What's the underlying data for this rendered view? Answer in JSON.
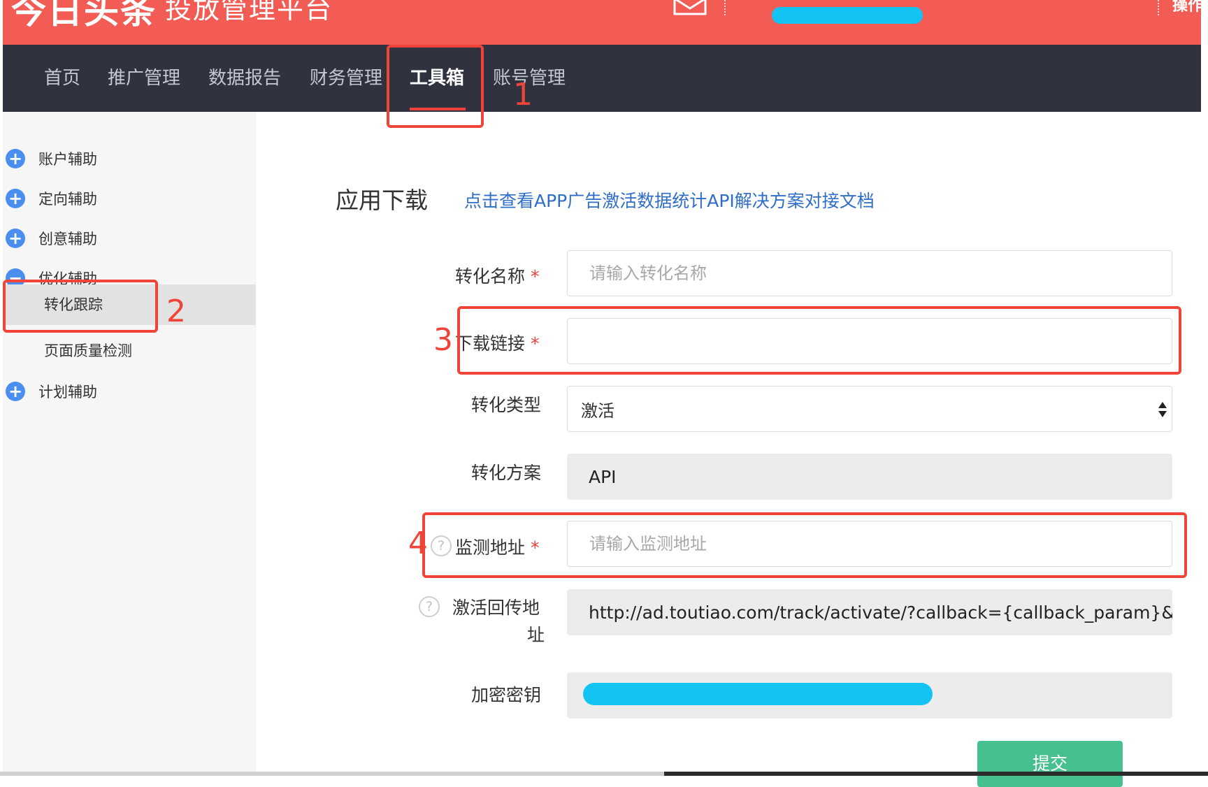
{
  "topbar": {
    "brand_logo": "今日头条",
    "brand_sub": "投放管理平台",
    "right_text": "操作",
    "icons": [
      "mail-icon"
    ],
    "user_masked_color": "#12c3f4"
  },
  "nav": {
    "items": [
      "首页",
      "推广管理",
      "数据报告",
      "财务管理",
      "工具箱",
      "账号管理"
    ],
    "active_index": 4
  },
  "sidebar": {
    "groups": [
      {
        "label": "账户辅助",
        "icon": "plus-icon"
      },
      {
        "label": "定向辅助",
        "icon": "plus-icon"
      },
      {
        "label": "创意辅助",
        "icon": "plus-icon"
      },
      {
        "label": "优化辅助",
        "icon": "minus-icon"
      },
      {
        "label": "计划辅助",
        "icon": "plus-icon"
      }
    ],
    "subitems": [
      "转化跟踪",
      "页面质量检测"
    ],
    "active_subitem": 0
  },
  "main": {
    "title": "应用下载",
    "doc_link": "点击查看APP广告激活数据统计API解决方案对接文档",
    "form": {
      "name_label": "转化名称",
      "name_placeholder": "请输入转化名称",
      "link_label": "下载链接",
      "link_value": "",
      "type_label": "转化类型",
      "type_value": "激活",
      "scheme_label": "转化方案",
      "scheme_value": "API",
      "monitor_label": "监测地址",
      "monitor_placeholder": "请输入监测地址",
      "callback_label_line1": "激活回传地",
      "callback_label_line2": "址",
      "callback_value": "http://ad.toutiao.com/track/activate/?callback={callback_param}&m",
      "key_label": "加密密钥",
      "key_masked_color": "#12c3f4",
      "required_mark": "*",
      "help_mark": "?"
    },
    "submit_label": "提交"
  },
  "annotations": [
    "1",
    "2",
    "3",
    "4"
  ],
  "colors": {
    "brand_red": "#f35c54",
    "nav_bg": "#30323f",
    "link_blue": "#2f6ec8",
    "annotation_red": "#ef4437",
    "submit_green": "#46c08f",
    "sidebar_icon_blue": "#4a8ef0"
  }
}
